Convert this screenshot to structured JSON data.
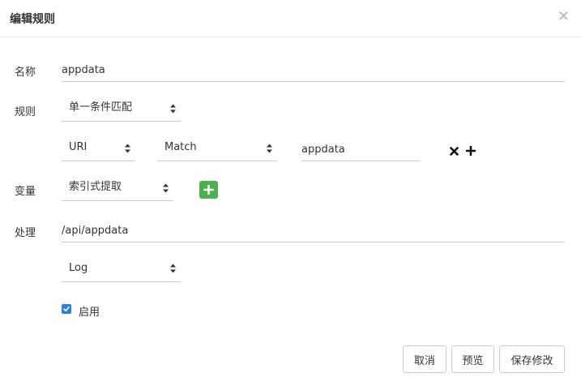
{
  "dialog": {
    "title": "编辑规则"
  },
  "form": {
    "name": {
      "label": "名称",
      "value": "appdata"
    },
    "rule": {
      "label": "规则",
      "mode": "单一条件匹配",
      "condition": {
        "field": "URI",
        "operator": "Match",
        "value": "appdata"
      }
    },
    "variable": {
      "label": "变量",
      "mode": "索引式提取"
    },
    "handler": {
      "label": "处理",
      "value": "/api/appdata",
      "action": "Log"
    },
    "enabled": {
      "label": "启用",
      "checked": true
    }
  },
  "footer": {
    "cancel_label": "取消",
    "preview_label": "预览",
    "save_label": "保存修改"
  },
  "colors": {
    "accent_green": "#4caf50",
    "checkbox_blue": "#2d7fd6"
  },
  "icons": {
    "close": "close-icon",
    "remove_condition": "remove-icon",
    "add_condition": "plus-icon",
    "add_variable": "plus-icon",
    "select_arrows": "sort-arrows-icon"
  }
}
